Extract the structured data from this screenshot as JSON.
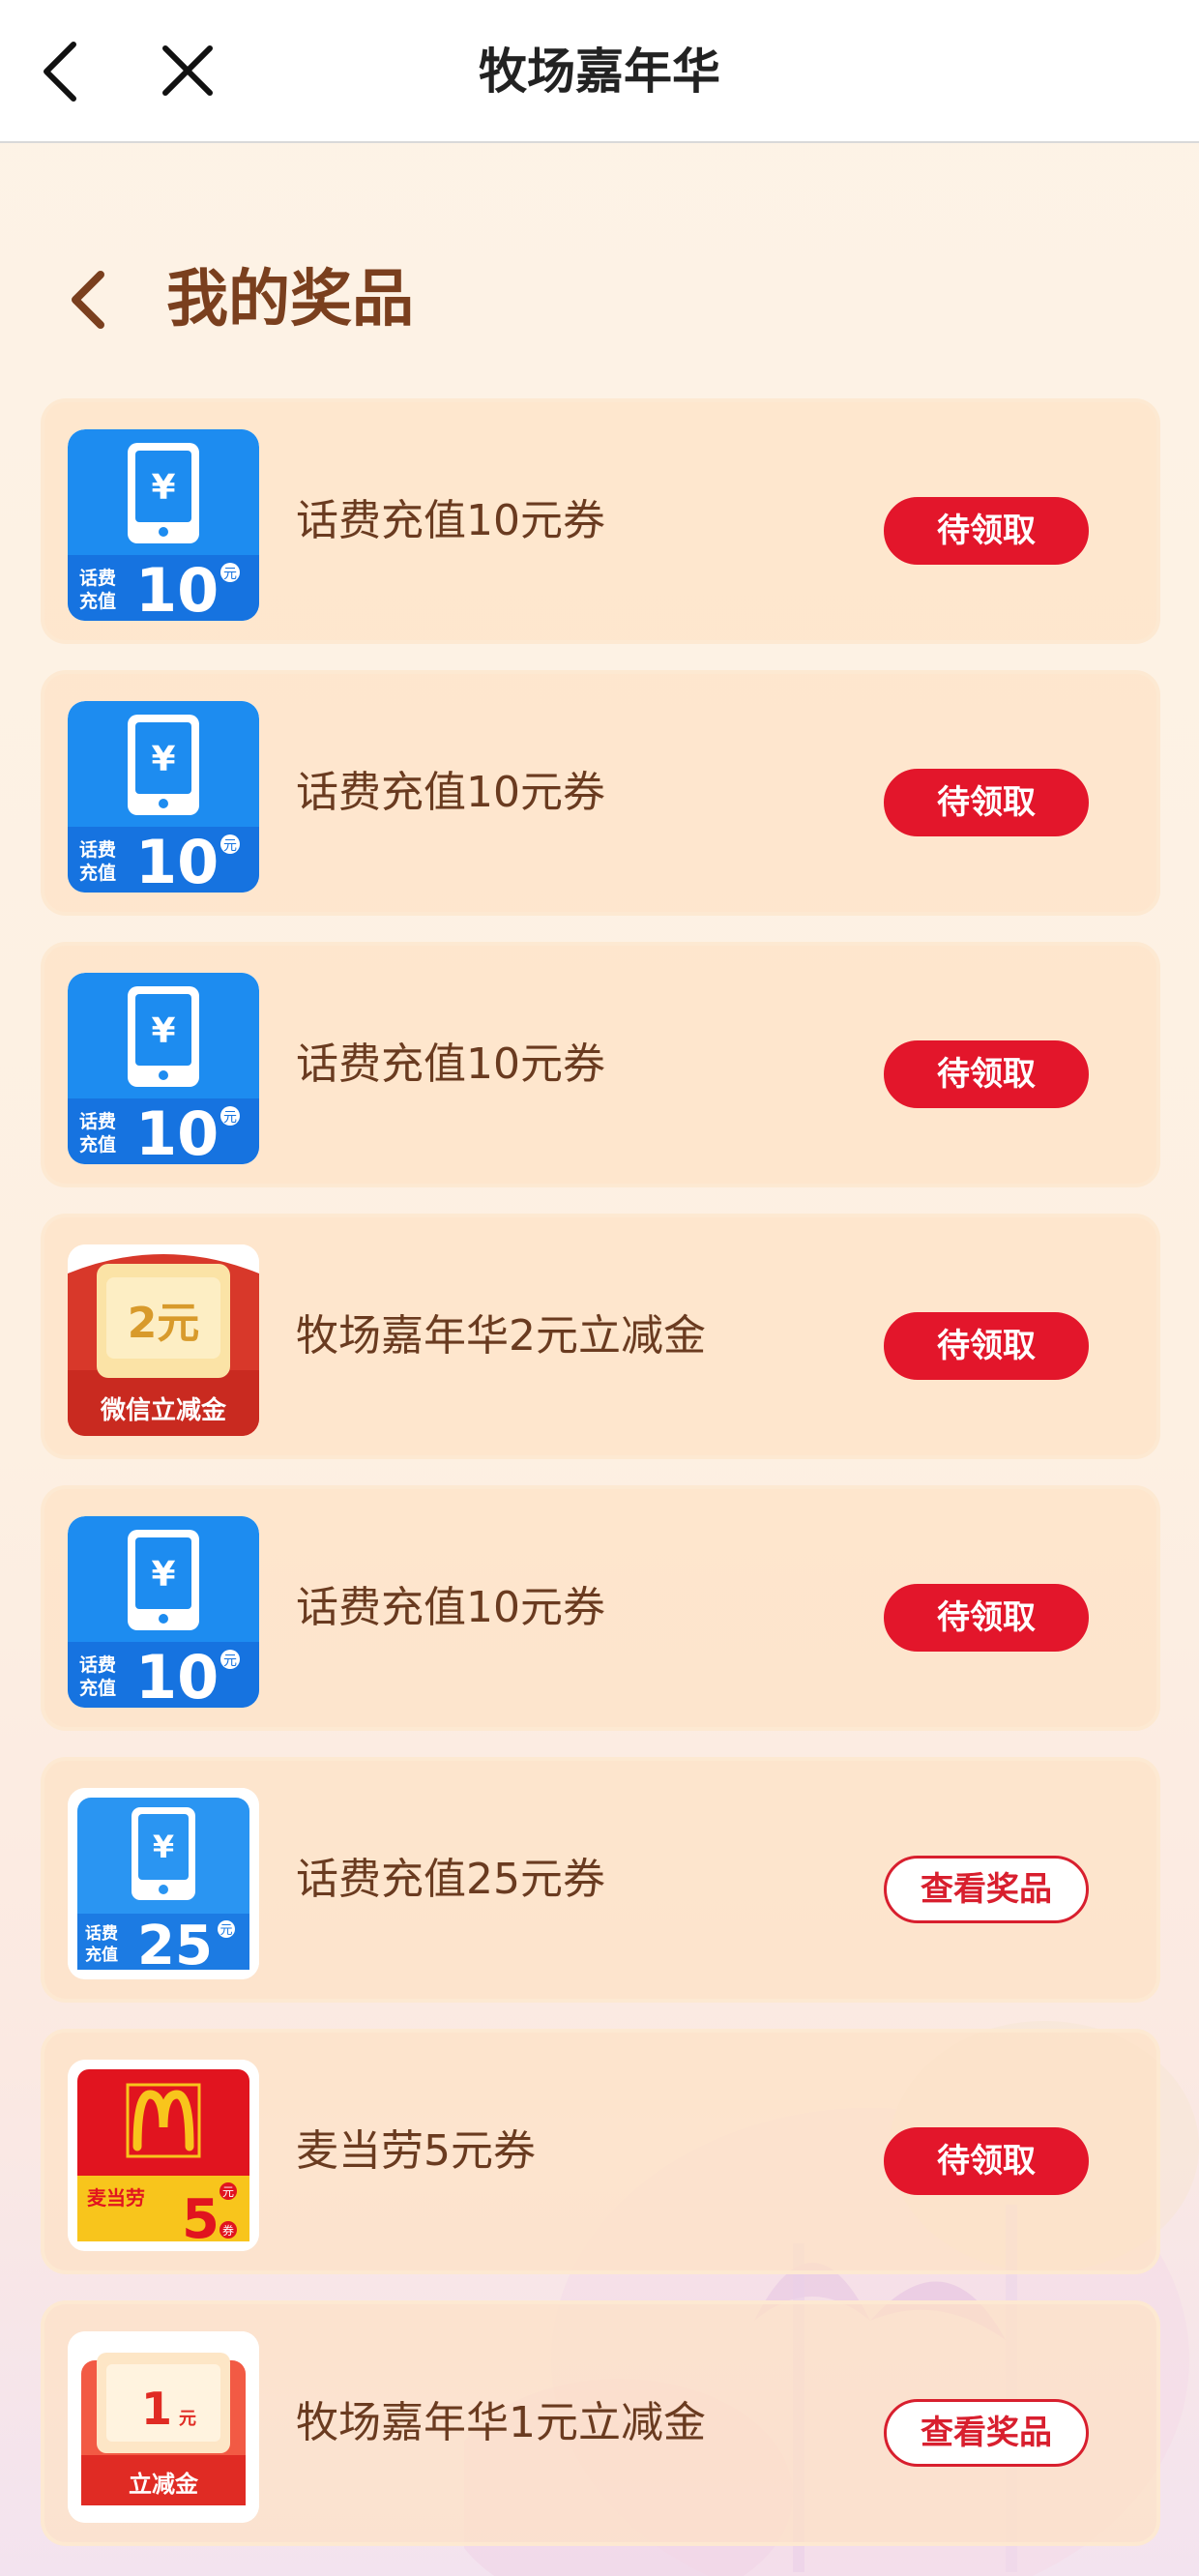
{
  "nav": {
    "title": "牧场嘉年华"
  },
  "header": {
    "title": "我的奖品"
  },
  "prizes": [
    {
      "name": "话费充值10元券",
      "thumb": "phone-credit-icon",
      "thumb_amount": "10",
      "thumb_label_top": "话费",
      "thumb_label_bottom": "充值",
      "thumb_unit": "元",
      "action": "待领取",
      "action_style": "filled"
    },
    {
      "name": "话费充值10元券",
      "thumb": "phone-credit-icon",
      "thumb_amount": "10",
      "thumb_label_top": "话费",
      "thumb_label_bottom": "充值",
      "thumb_unit": "元",
      "action": "待领取",
      "action_style": "filled"
    },
    {
      "name": "话费充值10元券",
      "thumb": "phone-credit-icon",
      "thumb_amount": "10",
      "thumb_label_top": "话费",
      "thumb_label_bottom": "充值",
      "thumb_unit": "元",
      "action": "待领取",
      "action_style": "filled"
    },
    {
      "name": "牧场嘉年华2元立减金",
      "thumb": "wechat-discount-icon",
      "thumb_amount": "2元",
      "thumb_caption": "微信立减金",
      "action": "待领取",
      "action_style": "filled"
    },
    {
      "name": "话费充值10元券",
      "thumb": "phone-credit-icon",
      "thumb_amount": "10",
      "thumb_label_top": "话费",
      "thumb_label_bottom": "充值",
      "thumb_unit": "元",
      "action": "待领取",
      "action_style": "filled"
    },
    {
      "name": "话费充值25元券",
      "thumb": "phone-credit-icon",
      "thumb_amount": "25",
      "thumb_label_top": "话费",
      "thumb_label_bottom": "充值",
      "thumb_unit": "元",
      "action": "查看奖品",
      "action_style": "outline"
    },
    {
      "name": "麦当劳5元券",
      "thumb": "mcdonalds-coupon-icon",
      "thumb_amount": "5",
      "thumb_caption": "麦当劳",
      "thumb_unit": "元",
      "thumb_unit2": "券",
      "action": "待领取",
      "action_style": "filled"
    },
    {
      "name": "牧场嘉年华1元立减金",
      "thumb": "discount-1yuan-icon",
      "thumb_amount": "1",
      "thumb_unit": "元",
      "thumb_caption": "立减金",
      "action": "查看奖品",
      "action_style": "outline"
    }
  ],
  "colors": {
    "accent": "#e3162b",
    "title_brown": "#7a3f1e",
    "card_bg": "#fde2c5",
    "phone_blue": "#1a8ff0"
  }
}
